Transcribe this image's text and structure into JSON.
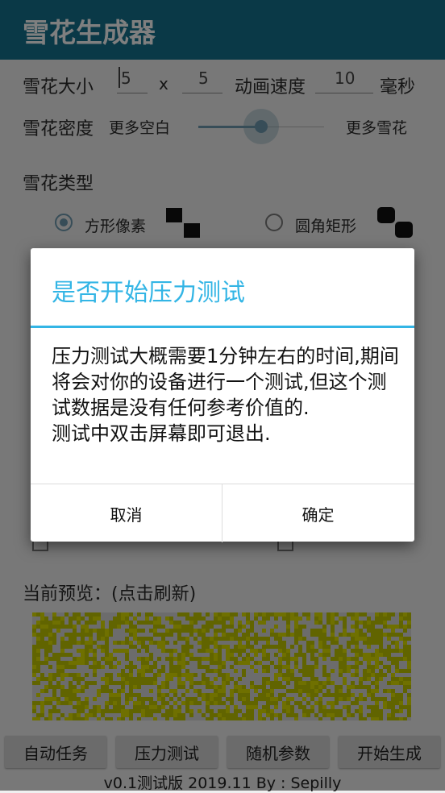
{
  "app": {
    "title": "雪花生成器"
  },
  "size_row": {
    "label": "雪花大小",
    "width_value": "5",
    "times": "x",
    "height_value": "5",
    "speed_label": "动画速度",
    "speed_value": "10",
    "speed_unit": "毫秒"
  },
  "density_row": {
    "label": "雪花密度",
    "left_label": "更多空白",
    "right_label": "更多雪花",
    "level": 0.5
  },
  "type_section": {
    "label": "雪花类型",
    "options": [
      {
        "label": "方形像素",
        "selected": true,
        "icon": "square-pixel-icon"
      },
      {
        "label": "圆角矩形",
        "selected": false,
        "icon": "rounded-rect-icon"
      }
    ]
  },
  "preview": {
    "label": "当前预览：(点击刷新)",
    "colors": [
      "#c3c800",
      "#dfe000",
      "#dadada"
    ]
  },
  "bottom_buttons": [
    "自动任务",
    "压力测试",
    "随机参数",
    "开始生成"
  ],
  "footer": "v0.1测试版  2019.11  By : Sepilly",
  "dialog": {
    "title": "是否开始压力测试",
    "message": "压力测试大概需要1分钟左右的时间,期间将会对你的设备进行一个测试,但这个测试数据是没有任何参考价值的.\n测试中双击屏幕即可退出.",
    "cancel": "取消",
    "confirm": "确定"
  },
  "colors": {
    "appbar": "#15738f",
    "accent": "#33b5e5",
    "slider": "#6f9bb0"
  }
}
